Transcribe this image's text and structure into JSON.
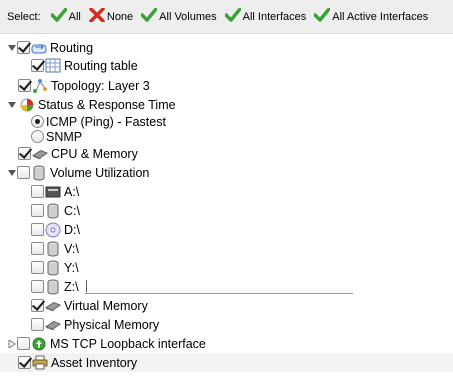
{
  "toolbar": {
    "select_label": "Select:",
    "all": "All",
    "none": "None",
    "all_volumes": "All Volumes",
    "all_interfaces": "All Interfaces",
    "all_active_interfaces": "All Active Interfaces"
  },
  "tree": {
    "routing": {
      "label": "Routing",
      "checked": true,
      "expanded": true
    },
    "routing_table": {
      "label": "Routing table",
      "checked": true
    },
    "topology": {
      "label": "Topology: Layer 3",
      "checked": true
    },
    "status": {
      "label": "Status & Response Time",
      "expanded": true
    },
    "icmp": {
      "label": "ICMP (Ping) - Fastest",
      "selected": true
    },
    "snmp": {
      "label": "SNMP",
      "selected": false
    },
    "cpu": {
      "label": "CPU & Memory",
      "checked": true
    },
    "volume": {
      "label": "Volume Utilization",
      "checked": false,
      "expanded": true
    },
    "vol_a": {
      "label": "A:\\",
      "checked": false
    },
    "vol_c": {
      "label": "C:\\",
      "checked": false
    },
    "vol_d": {
      "label": "D:\\",
      "checked": false
    },
    "vol_v": {
      "label": "V:\\",
      "checked": false
    },
    "vol_y": {
      "label": "Y:\\",
      "checked": false
    },
    "vol_z": {
      "label": "Z:\\",
      "checked": false
    },
    "virtual_memory": {
      "label": "Virtual Memory",
      "checked": true
    },
    "physical_memory": {
      "label": "Physical Memory",
      "checked": false
    },
    "ms_tcp": {
      "label": "MS TCP Loopback interface",
      "checked": false,
      "expanded": false
    },
    "asset": {
      "label": "Asset Inventory",
      "checked": true
    }
  },
  "colors": {
    "check_green": "#3aa335",
    "none_red": "#d62b1e",
    "toolbar_bg": "#eeeeee"
  }
}
